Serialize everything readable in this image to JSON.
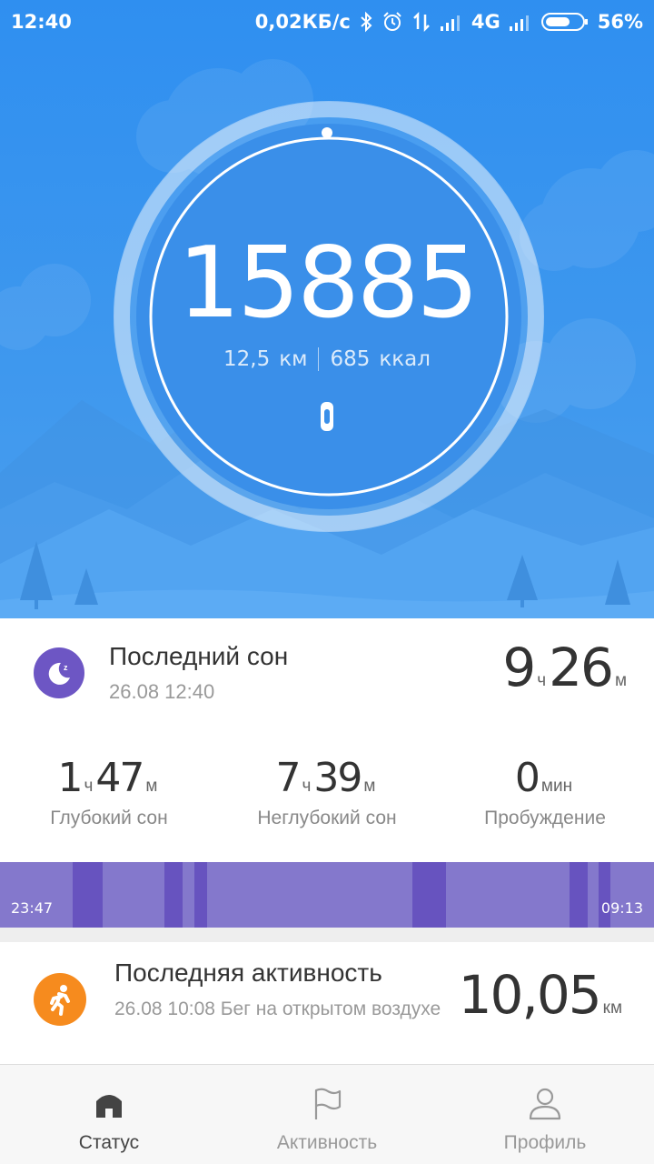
{
  "status_bar": {
    "time": "12:40",
    "speed": "0,02КБ/с",
    "network": "4G",
    "battery": "56%"
  },
  "steps": {
    "value": "15885",
    "distance_value": "12,5",
    "distance_unit": "км",
    "calories_value": "685",
    "calories_unit": "ккал"
  },
  "sleep": {
    "title": "Последний сон",
    "date": "26.08 12:40",
    "total_hours": "9",
    "hours_unit": "ч",
    "total_minutes": "26",
    "minutes_unit": "м",
    "stats": [
      {
        "hours": "1",
        "h_unit": "ч",
        "minutes": "47",
        "m_unit": "м",
        "label": "Глубокий сон"
      },
      {
        "hours": "7",
        "h_unit": "ч",
        "minutes": "39",
        "m_unit": "м",
        "label": "Неглубокий сон"
      },
      {
        "value": "0",
        "unit": "мин",
        "label": "Пробуждение"
      }
    ],
    "start_time": "23:47",
    "end_time": "09:13",
    "light_color": "#8478cc",
    "deep_color": "#6753bf"
  },
  "activity": {
    "title": "Последняя активность",
    "description": "26.08 10:08 Бег на открытом воздухе",
    "distance": "10,05",
    "distance_unit": "км"
  },
  "nav": {
    "status": "Статус",
    "activity": "Активность",
    "profile": "Профиль"
  },
  "colors": {
    "hero": "#3d97ee",
    "sleep_icon": "#6d56c4",
    "activity_icon": "#f68b1e"
  }
}
